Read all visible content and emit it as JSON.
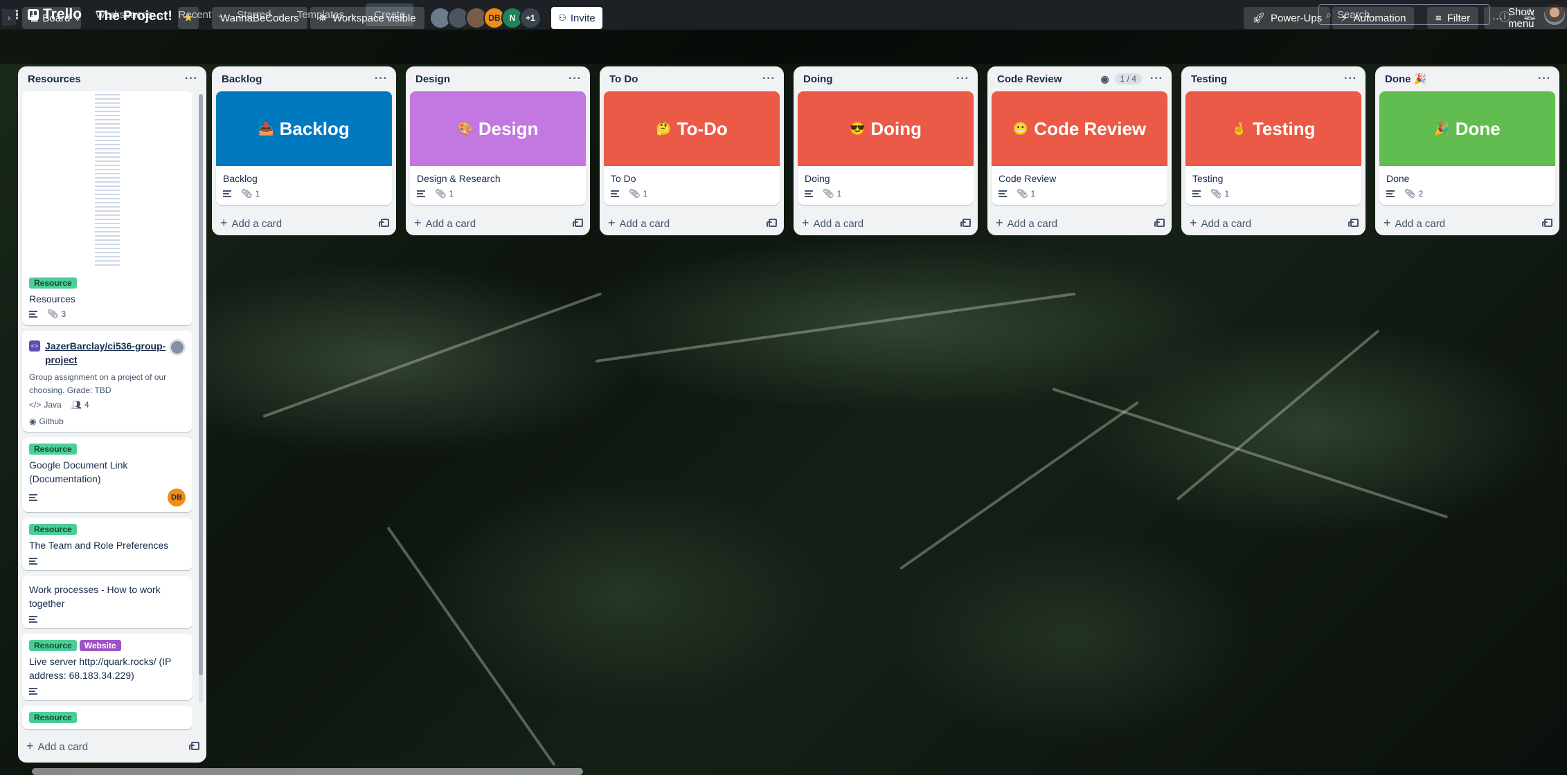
{
  "topnav": {
    "logo": "Trello",
    "menus": [
      "Workspaces",
      "Recent",
      "Starred",
      "Templates"
    ],
    "create": "Create",
    "search_placeholder": "Search"
  },
  "board": {
    "view": "Board",
    "title": "The Project!",
    "workspace": "WannaBeCoders",
    "visibility": "Workspace visible",
    "members": [
      {
        "initials": "",
        "color": "#6a7b8c"
      },
      {
        "initials": "",
        "color": "#4a5561"
      },
      {
        "initials": "",
        "color": "#7a5a48"
      },
      {
        "initials": "DB",
        "color": "#f18d13"
      },
      {
        "initials": "N",
        "color": "#1f845a"
      },
      {
        "initials": "+1",
        "color": "#3a444d"
      }
    ],
    "invite": "Invite",
    "powerups": "Power-Ups",
    "automation": "Automation",
    "filter": "Filter",
    "show_menu": "Show menu"
  },
  "resources": {
    "name": "Resources",
    "cards": {
      "c1": {
        "label": "Resource",
        "title": "Resources",
        "attachments": "3"
      },
      "c2": {
        "link": "JazerBarclay/ci536-group-project",
        "desc": "Group assignment on a project of our choosing. Grade: TBD",
        "lang": "Java",
        "people": "4",
        "source": "Github"
      },
      "c3": {
        "label": "Resource",
        "title": "Google Document Link (Documentation)",
        "member": "DB"
      },
      "c4": {
        "label": "Resource",
        "title": "The Team and Role Preferences"
      },
      "c5": {
        "title": "Work processes - How to work together"
      },
      "c6": {
        "label": "Resource",
        "label2": "Website",
        "title": "Live server http://quark.rocks/ (IP address: 68.183.34.229)"
      },
      "c7": {
        "label": "Resource"
      }
    },
    "add_card": "Add a card"
  },
  "lists": [
    {
      "name": "Backlog",
      "cover": "Backlog",
      "emoji": "📥",
      "color": "#0079bf",
      "card": "Backlog",
      "att": "1",
      "add": "Add a card"
    },
    {
      "name": "Design",
      "cover": "Design",
      "emoji": "🎨",
      "color": "#c377e0",
      "card": "Design & Research",
      "att": "1",
      "add": "Add a card"
    },
    {
      "name": "To Do",
      "cover": "To-Do",
      "emoji": "🤔",
      "color": "#eb5a46",
      "card": "To Do",
      "att": "1",
      "add": "Add a card"
    },
    {
      "name": "Doing",
      "cover": "Doing",
      "emoji": "😎",
      "color": "#eb5a46",
      "card": "Doing",
      "att": "1",
      "add": "Add a card"
    },
    {
      "name": "Code Review",
      "cover": "Code Review",
      "emoji": "😬",
      "color": "#eb5a46",
      "card": "Code Review",
      "att": "1",
      "add": "Add a card",
      "watch": "1 / 4"
    },
    {
      "name": "Testing",
      "cover": "Testing",
      "emoji": "🤞",
      "color": "#eb5a46",
      "card": "Testing",
      "att": "1",
      "add": "Add a card"
    },
    {
      "name": "Done 🎉",
      "cover": "Done",
      "emoji": "🎉",
      "color": "#61bd4f",
      "card": "Done",
      "att": "2",
      "add": "Add a card"
    }
  ]
}
